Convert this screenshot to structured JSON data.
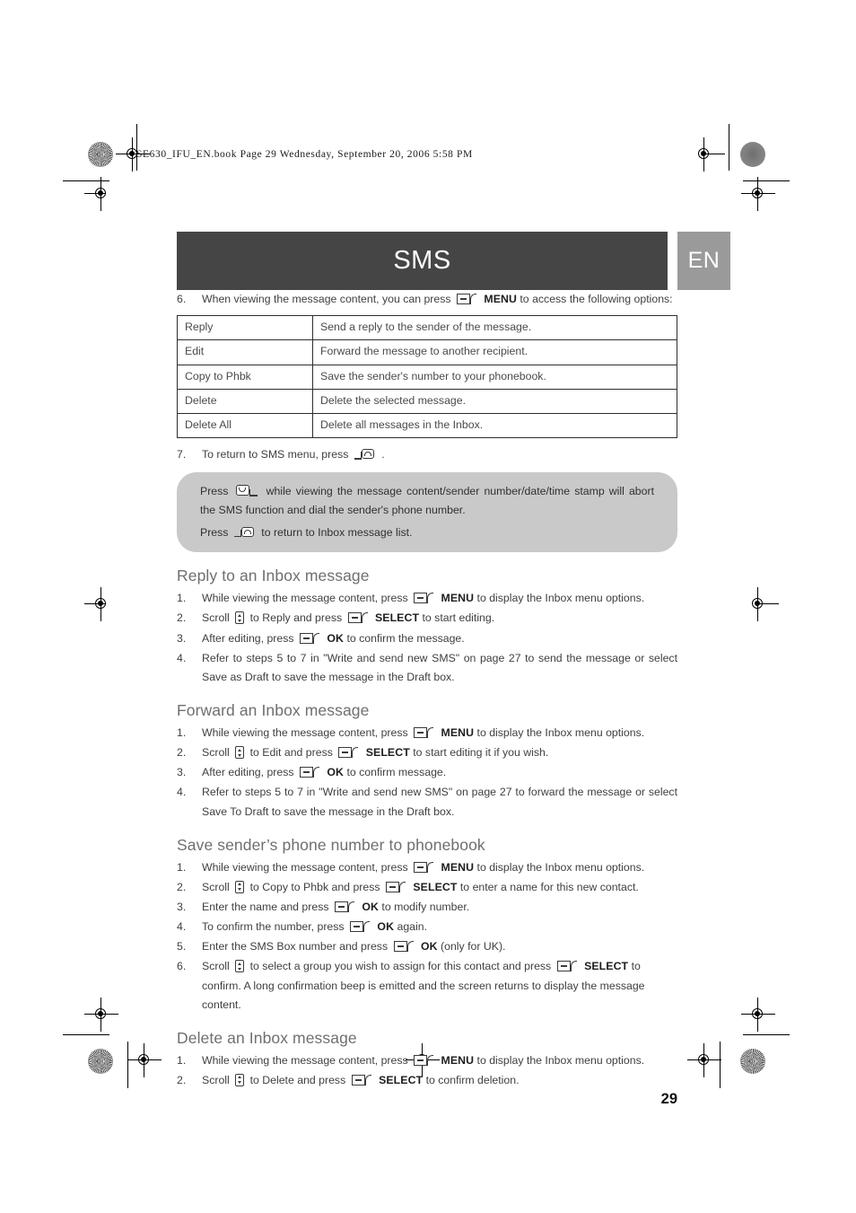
{
  "file_banner": "SE630_IFU_EN.book  Page 29  Wednesday, September 20, 2006  5:58 PM",
  "header": {
    "title": "SMS",
    "language": "EN",
    "banner_color": "#454545",
    "language_color": "#9a9a9a"
  },
  "intro_step": {
    "num": "6.",
    "before": "When viewing the message content, you can press",
    "key_label": "MENU",
    "after": "to access the following options:"
  },
  "options_table": {
    "rows": [
      {
        "option": "Reply",
        "description": "Send a reply to the sender of the message."
      },
      {
        "option": "Edit",
        "description": "Forward the message to another recipient."
      },
      {
        "option": "Copy to Phbk",
        "description": "Save the sender's number to your phonebook."
      },
      {
        "option": "Delete",
        "description": "Delete the selected message."
      },
      {
        "option": "Delete All",
        "description": "Delete all messages in the Inbox."
      }
    ]
  },
  "step7": {
    "num": "7.",
    "before": "To return to SMS menu, press",
    "after": "."
  },
  "note": {
    "line1_before": "Press",
    "line1_after": "while viewing the message content/sender number/date/time stamp will abort the SMS function and dial the sender's phone number.",
    "line2_before": "Press",
    "line2_after": "to return to Inbox message list.",
    "background": "#c9c9c9"
  },
  "sections": [
    {
      "heading": "Reply to an Inbox message",
      "steps": [
        {
          "num": "1.",
          "parts": [
            {
              "t": "text",
              "v": "While viewing the message content, press"
            },
            {
              "t": "key",
              "v": "soft"
            },
            {
              "t": "bold",
              "v": "MENU"
            },
            {
              "t": "text",
              "v": "to display the Inbox menu options."
            }
          ]
        },
        {
          "num": "2.",
          "parts": [
            {
              "t": "text",
              "v": "Scroll"
            },
            {
              "t": "key",
              "v": "scroll"
            },
            {
              "t": "text",
              "v": "to Reply and press"
            },
            {
              "t": "key",
              "v": "soft"
            },
            {
              "t": "bold",
              "v": "SELECT"
            },
            {
              "t": "text",
              "v": "to start editing."
            }
          ]
        },
        {
          "num": "3.",
          "parts": [
            {
              "t": "text",
              "v": "After editing, press"
            },
            {
              "t": "key",
              "v": "soft"
            },
            {
              "t": "bold",
              "v": "OK"
            },
            {
              "t": "text",
              "v": "to confirm the message."
            }
          ]
        },
        {
          "num": "4.",
          "parts": [
            {
              "t": "text",
              "v": "Refer to steps 5 to 7 in \"Write and send new SMS\" on page 27 to send the message or select Save as Draft to save the message in the Draft box."
            }
          ]
        }
      ]
    },
    {
      "heading": "Forward an Inbox message",
      "steps": [
        {
          "num": "1.",
          "parts": [
            {
              "t": "text",
              "v": "While viewing the message content, press"
            },
            {
              "t": "key",
              "v": "soft"
            },
            {
              "t": "bold",
              "v": "MENU"
            },
            {
              "t": "text",
              "v": "to display the Inbox menu options."
            }
          ]
        },
        {
          "num": "2.",
          "parts": [
            {
              "t": "text",
              "v": "Scroll"
            },
            {
              "t": "key",
              "v": "scroll"
            },
            {
              "t": "text",
              "v": "to Edit and press"
            },
            {
              "t": "key",
              "v": "soft"
            },
            {
              "t": "bold",
              "v": "SELECT"
            },
            {
              "t": "text",
              "v": "to start editing it if you wish."
            }
          ]
        },
        {
          "num": "3.",
          "parts": [
            {
              "t": "text",
              "v": "After editing, press"
            },
            {
              "t": "key",
              "v": "soft"
            },
            {
              "t": "bold",
              "v": "OK"
            },
            {
              "t": "text",
              "v": "to confirm message."
            }
          ]
        },
        {
          "num": "4.",
          "parts": [
            {
              "t": "text",
              "v": "Refer to steps 5 to 7 in \"Write and send new SMS\" on page 27 to forward the message or select Save To Draft to save the message in the Draft box."
            }
          ]
        }
      ]
    },
    {
      "heading": "Save sender’s phone number to phonebook",
      "steps": [
        {
          "num": "1.",
          "parts": [
            {
              "t": "text",
              "v": "While viewing the message content, press"
            },
            {
              "t": "key",
              "v": "soft"
            },
            {
              "t": "bold",
              "v": "MENU"
            },
            {
              "t": "text",
              "v": "to display the Inbox menu options."
            }
          ]
        },
        {
          "num": "2.",
          "parts": [
            {
              "t": "text",
              "v": "Scroll"
            },
            {
              "t": "key",
              "v": "scroll"
            },
            {
              "t": "text",
              "v": "to Copy to Phbk and press"
            },
            {
              "t": "key",
              "v": "soft"
            },
            {
              "t": "bold",
              "v": "SELECT"
            },
            {
              "t": "text",
              "v": "to enter a name for this new contact."
            }
          ]
        },
        {
          "num": "3.",
          "parts": [
            {
              "t": "text",
              "v": "Enter the name and press"
            },
            {
              "t": "key",
              "v": "soft"
            },
            {
              "t": "bold",
              "v": "OK"
            },
            {
              "t": "text",
              "v": "to modify number."
            }
          ]
        },
        {
          "num": "4.",
          "parts": [
            {
              "t": "text",
              "v": "To confirm the number, press"
            },
            {
              "t": "key",
              "v": "soft"
            },
            {
              "t": "bold",
              "v": "OK"
            },
            {
              "t": "text",
              "v": "again."
            }
          ]
        },
        {
          "num": "5.",
          "parts": [
            {
              "t": "text",
              "v": "Enter the SMS Box number and press"
            },
            {
              "t": "key",
              "v": "soft"
            },
            {
              "t": "bold",
              "v": "OK"
            },
            {
              "t": "text",
              "v": "(only for UK)."
            }
          ]
        },
        {
          "num": "6.",
          "parts": [
            {
              "t": "text",
              "v": "Scroll"
            },
            {
              "t": "key",
              "v": "scroll"
            },
            {
              "t": "text",
              "v": "to select a group you wish to assign for this contact and press"
            },
            {
              "t": "key",
              "v": "soft"
            },
            {
              "t": "bold",
              "v": "SELECT"
            },
            {
              "t": "text",
              "v": "to confirm. A long confirmation beep is emitted and the screen returns to display the message content."
            }
          ]
        }
      ]
    },
    {
      "heading": "Delete an Inbox message",
      "steps": [
        {
          "num": "1.",
          "parts": [
            {
              "t": "text",
              "v": "While viewing the message content, press"
            },
            {
              "t": "key",
              "v": "soft"
            },
            {
              "t": "bold",
              "v": "MENU"
            },
            {
              "t": "text",
              "v": "to display the Inbox menu options."
            }
          ]
        },
        {
          "num": "2.",
          "parts": [
            {
              "t": "text",
              "v": "Scroll"
            },
            {
              "t": "key",
              "v": "scroll"
            },
            {
              "t": "text",
              "v": "to Delete and press"
            },
            {
              "t": "key",
              "v": "soft"
            },
            {
              "t": "bold",
              "v": "SELECT"
            },
            {
              "t": "text",
              "v": "to confirm deletion."
            }
          ]
        }
      ]
    }
  ],
  "page_number": "29",
  "icons": {
    "soft": "soft-key-icon",
    "scroll": "scroll-key-icon",
    "call": "call-key-icon",
    "end": "end-key-icon"
  }
}
